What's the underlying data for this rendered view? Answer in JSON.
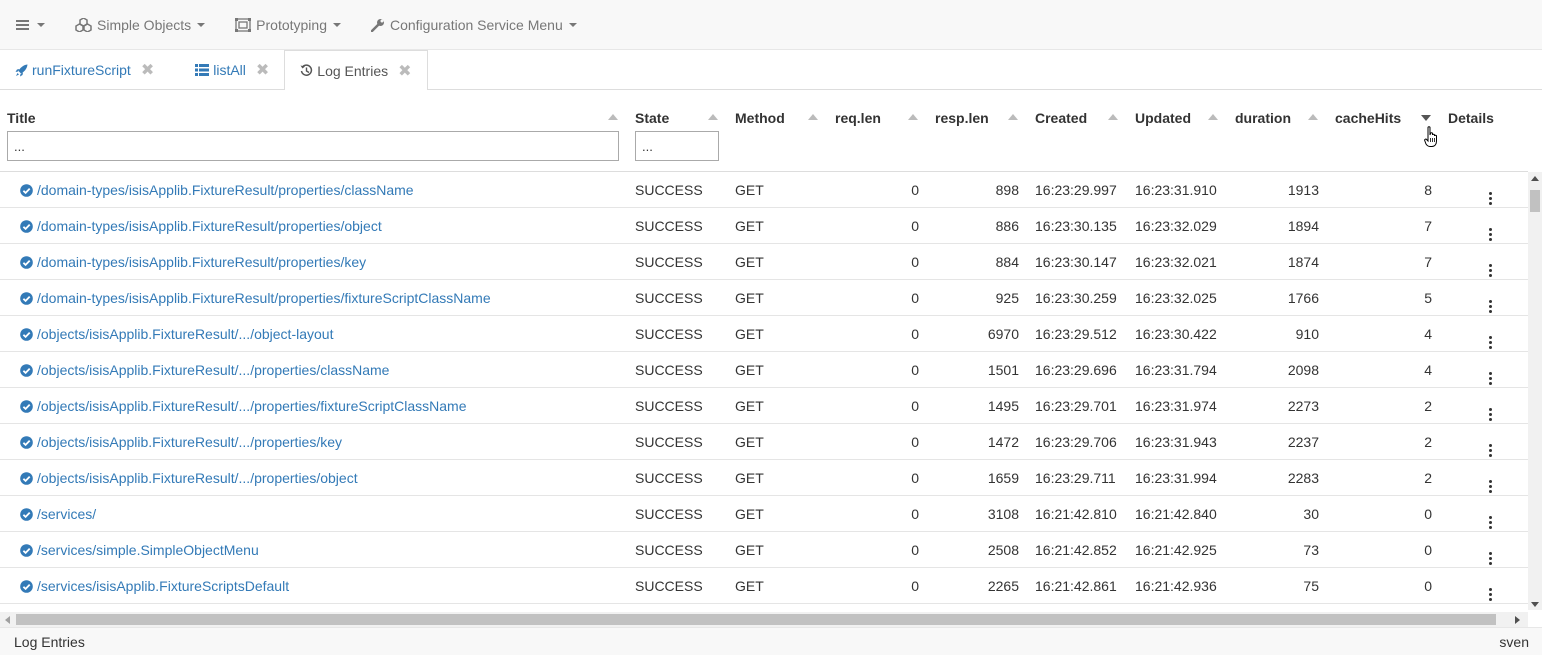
{
  "menubar": {
    "items": [
      {
        "label": "",
        "icon": "hamburger-icon"
      },
      {
        "label": "Simple Objects",
        "icon": "cubes-icon"
      },
      {
        "label": "Prototyping",
        "icon": "object-ungroup-icon"
      },
      {
        "label": "Configuration Service Menu",
        "icon": "wrench-icon"
      }
    ]
  },
  "tabs": [
    {
      "label": "runFixtureScript",
      "icon": "rocket-icon",
      "active": false
    },
    {
      "label": "listAll",
      "icon": "list-icon",
      "active": false
    },
    {
      "label": "Log Entries",
      "icon": "history-icon",
      "active": true
    }
  ],
  "grid": {
    "columns": [
      {
        "key": "title",
        "label": "Title"
      },
      {
        "key": "state",
        "label": "State"
      },
      {
        "key": "method",
        "label": "Method"
      },
      {
        "key": "reqlen",
        "label": "req.len"
      },
      {
        "key": "resplen",
        "label": "resp.len"
      },
      {
        "key": "created",
        "label": "Created"
      },
      {
        "key": "updated",
        "label": "Updated"
      },
      {
        "key": "duration",
        "label": "duration"
      },
      {
        "key": "cachehits",
        "label": "cacheHits",
        "sort": "desc"
      },
      {
        "key": "details",
        "label": "Details"
      }
    ],
    "filters": {
      "title": "...",
      "state": "..."
    },
    "rows": [
      {
        "title": "/domain-types/isisApplib.FixtureResult/properties/className",
        "state": "SUCCESS",
        "method": "GET",
        "reqlen": "0",
        "resplen": "898",
        "created": "16:23:29.997",
        "updated": "16:23:31.910",
        "duration": "1913",
        "cachehits": "8"
      },
      {
        "title": "/domain-types/isisApplib.FixtureResult/properties/object",
        "state": "SUCCESS",
        "method": "GET",
        "reqlen": "0",
        "resplen": "886",
        "created": "16:23:30.135",
        "updated": "16:23:32.029",
        "duration": "1894",
        "cachehits": "7"
      },
      {
        "title": "/domain-types/isisApplib.FixtureResult/properties/key",
        "state": "SUCCESS",
        "method": "GET",
        "reqlen": "0",
        "resplen": "884",
        "created": "16:23:30.147",
        "updated": "16:23:32.021",
        "duration": "1874",
        "cachehits": "7"
      },
      {
        "title": "/domain-types/isisApplib.FixtureResult/properties/fixtureScriptClassName",
        "state": "SUCCESS",
        "method": "GET",
        "reqlen": "0",
        "resplen": "925",
        "created": "16:23:30.259",
        "updated": "16:23:32.025",
        "duration": "1766",
        "cachehits": "5"
      },
      {
        "title": "/objects/isisApplib.FixtureResult/.../object-layout",
        "state": "SUCCESS",
        "method": "GET",
        "reqlen": "0",
        "resplen": "6970",
        "created": "16:23:29.512",
        "updated": "16:23:30.422",
        "duration": "910",
        "cachehits": "4"
      },
      {
        "title": "/objects/isisApplib.FixtureResult/.../properties/className",
        "state": "SUCCESS",
        "method": "GET",
        "reqlen": "0",
        "resplen": "1501",
        "created": "16:23:29.696",
        "updated": "16:23:31.794",
        "duration": "2098",
        "cachehits": "4"
      },
      {
        "title": "/objects/isisApplib.FixtureResult/.../properties/fixtureScriptClassName",
        "state": "SUCCESS",
        "method": "GET",
        "reqlen": "0",
        "resplen": "1495",
        "created": "16:23:29.701",
        "updated": "16:23:31.974",
        "duration": "2273",
        "cachehits": "2"
      },
      {
        "title": "/objects/isisApplib.FixtureResult/.../properties/key",
        "state": "SUCCESS",
        "method": "GET",
        "reqlen": "0",
        "resplen": "1472",
        "created": "16:23:29.706",
        "updated": "16:23:31.943",
        "duration": "2237",
        "cachehits": "2"
      },
      {
        "title": "/objects/isisApplib.FixtureResult/.../properties/object",
        "state": "SUCCESS",
        "method": "GET",
        "reqlen": "0",
        "resplen": "1659",
        "created": "16:23:29.711",
        "updated": "16:23:31.994",
        "duration": "2283",
        "cachehits": "2"
      },
      {
        "title": "/services/",
        "state": "SUCCESS",
        "method": "GET",
        "reqlen": "0",
        "resplen": "3108",
        "created": "16:21:42.810",
        "updated": "16:21:42.840",
        "duration": "30",
        "cachehits": "0"
      },
      {
        "title": "/services/simple.SimpleObjectMenu",
        "state": "SUCCESS",
        "method": "GET",
        "reqlen": "0",
        "resplen": "2508",
        "created": "16:21:42.852",
        "updated": "16:21:42.925",
        "duration": "73",
        "cachehits": "0"
      },
      {
        "title": "/services/isisApplib.FixtureScriptsDefault",
        "state": "SUCCESS",
        "method": "GET",
        "reqlen": "0",
        "resplen": "2265",
        "created": "16:21:42.861",
        "updated": "16:21:42.936",
        "duration": "75",
        "cachehits": "0"
      }
    ]
  },
  "footer": {
    "left": "Log Entries",
    "right": "sven"
  },
  "colors": {
    "link": "#337ab7",
    "success_icon": "#337ab7",
    "menubar_bg": "#f8f8f8",
    "menubar_text": "#777777"
  }
}
